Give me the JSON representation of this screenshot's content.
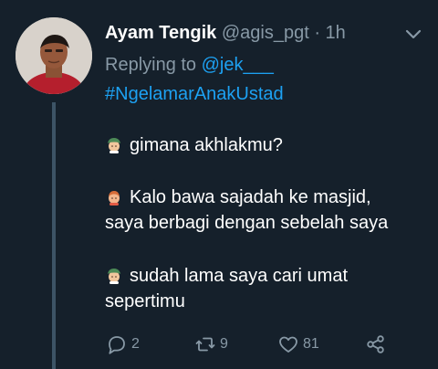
{
  "tweet": {
    "author": {
      "display_name": "Ayam Tengik",
      "handle": "@agis_pgt"
    },
    "separator": "·",
    "time": "1h",
    "reply": {
      "prefix": "Replying to ",
      "mention": "@jek___"
    },
    "hashtag": "#NgelamarAnakUstad",
    "body": {
      "line1": "gimana akhlakmu?",
      "line2": "Kalo bawa sajadah ke masjid,",
      "line3": "saya berbagi dengan sebelah saya",
      "line4": "sudah lama saya cari umat",
      "line5": "sepertimu"
    },
    "stats": {
      "replies": "2",
      "retweets": "9",
      "likes": "81"
    }
  },
  "icons": {
    "reply": "reply-icon",
    "retweet": "retweet-icon",
    "like": "heart-icon",
    "share": "share-icon",
    "caret": "chevron-down-icon",
    "emoji_a": "man-with-turban-emoji",
    "emoji_b": "person-emoji"
  },
  "colors": {
    "background": "#15202b",
    "text": "#ffffff",
    "muted": "#8899a6",
    "link": "#1da1f2",
    "thread_line": "#3d5466"
  }
}
